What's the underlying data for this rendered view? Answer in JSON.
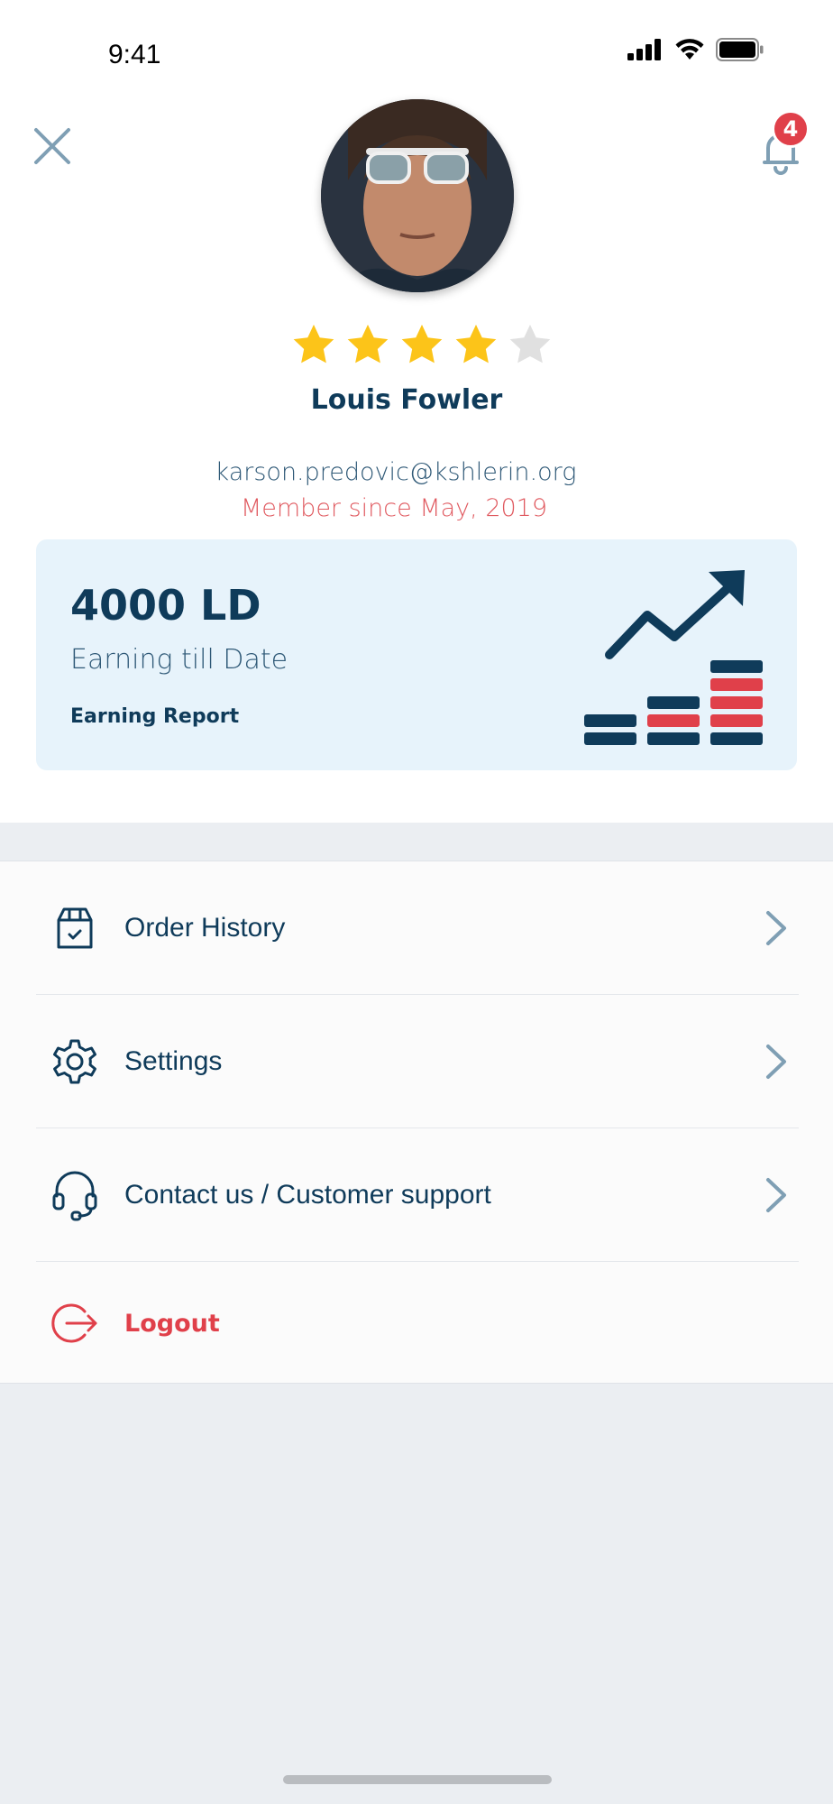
{
  "status_bar": {
    "time": "9:41"
  },
  "header": {
    "notification_count": "4"
  },
  "profile": {
    "name": "Louis Fowler",
    "email": "karson.predovic@kshlerin.org",
    "member_since": "Member since May, 2019",
    "rating": 4,
    "rating_max": 5
  },
  "earnings": {
    "amount": "4000 LD",
    "subtitle": "Earning till Date",
    "report_link": "Earning Report"
  },
  "menu": {
    "items": [
      {
        "label": "Order History",
        "icon": "package-icon"
      },
      {
        "label": "Settings",
        "icon": "gear-icon"
      },
      {
        "label": "Contact us / Customer support",
        "icon": "headset-icon"
      }
    ],
    "logout_label": "Logout"
  },
  "colors": {
    "primary": "#0f3b5a",
    "accent_red": "#e0404a",
    "card_bg": "#e7f3fb",
    "star_on": "#fcc419",
    "star_off": "#e0e0e0"
  }
}
